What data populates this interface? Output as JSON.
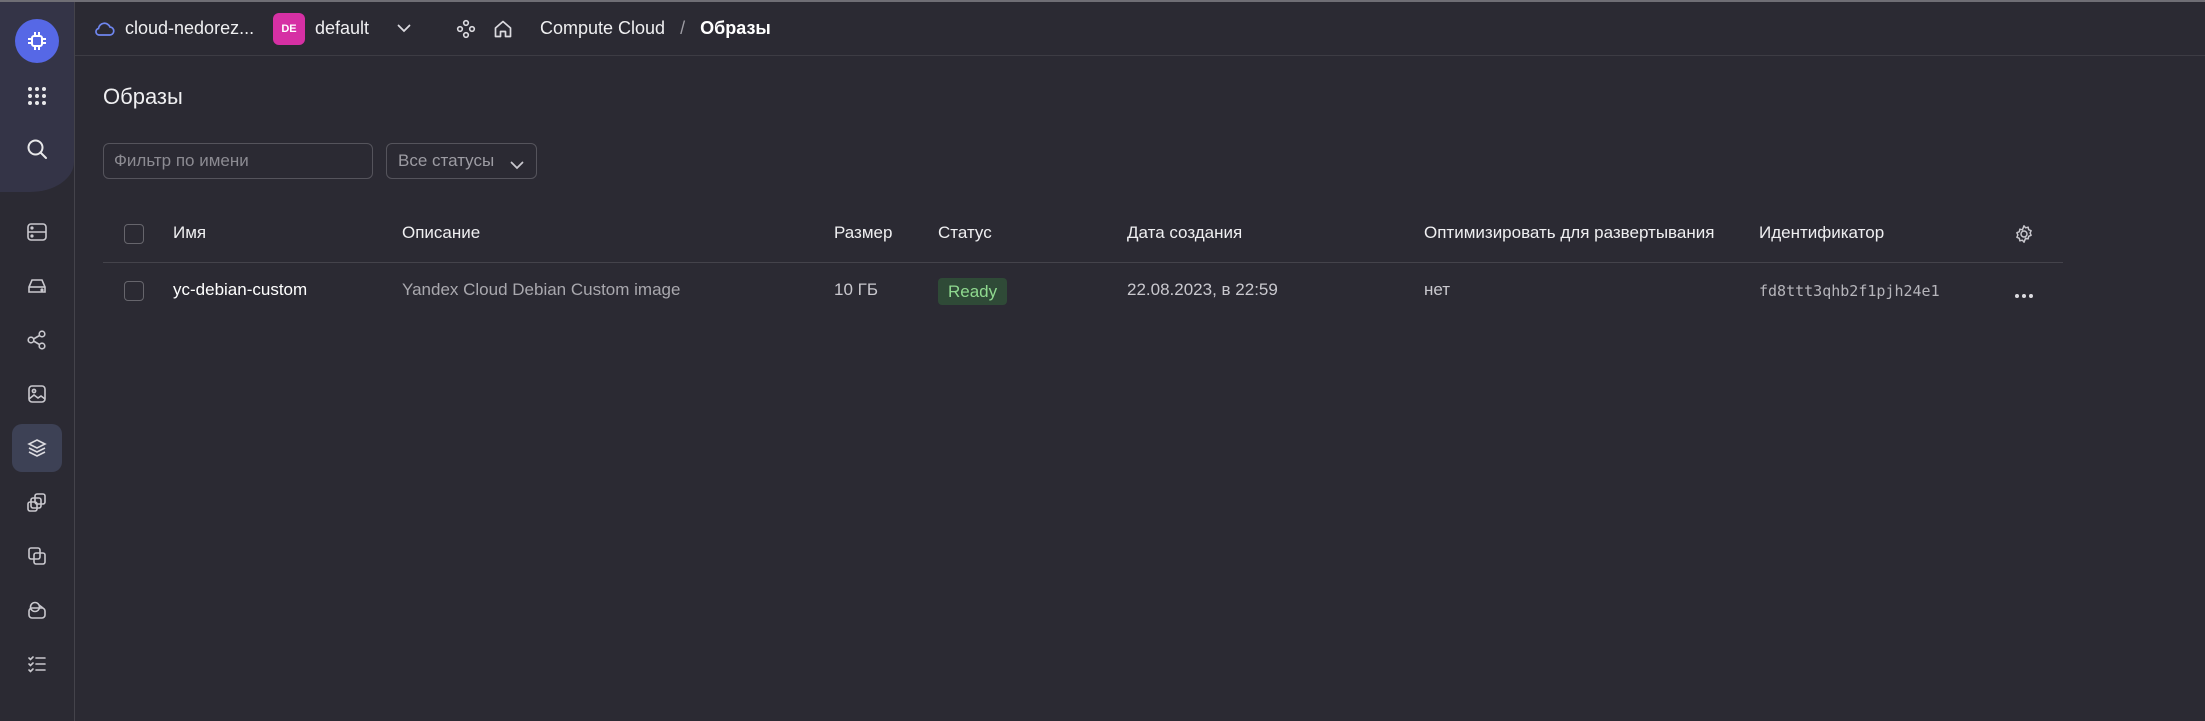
{
  "header": {
    "cloud_name": "cloud-nedorez...",
    "folder_badge": "DE",
    "folder_name": "default",
    "breadcrumb": [
      "Compute Cloud",
      "Образы"
    ],
    "breadcrumb_separator": "/"
  },
  "page": {
    "title": "Образы"
  },
  "filters": {
    "name_placeholder": "Фильтр по имени",
    "status_value": "Все статусы"
  },
  "table": {
    "columns": [
      "Имя",
      "Описание",
      "Размер",
      "Статус",
      "Дата создания",
      "Оптимизировать для развертывания",
      "Идентификатор"
    ],
    "rows": [
      {
        "name": "yc-debian-custom",
        "description": "Yandex Cloud Debian Custom image",
        "size": "10 ГБ",
        "status": "Ready",
        "created": "22.08.2023, в 22:59",
        "optimize": "нет",
        "id": "fd8ttt3qhb2f1pjh24e1"
      }
    ]
  },
  "sidebar": {
    "icons": [
      "compute-logo-icon",
      "apps-grid-icon",
      "search-icon",
      "virtual-machines-icon",
      "disks-icon",
      "placement-groups-icon",
      "images-icon",
      "snapshots-icon",
      "instance-groups-icon",
      "gpu-clusters-icon",
      "file-storage-icon",
      "operations-icon"
    ]
  },
  "colors": {
    "background": "#2b2a33",
    "accent": "#5668e6",
    "folder_badge": "#d630a4",
    "status_ready_bg": "#2f4a37",
    "status_ready_text": "#8fd98f"
  }
}
